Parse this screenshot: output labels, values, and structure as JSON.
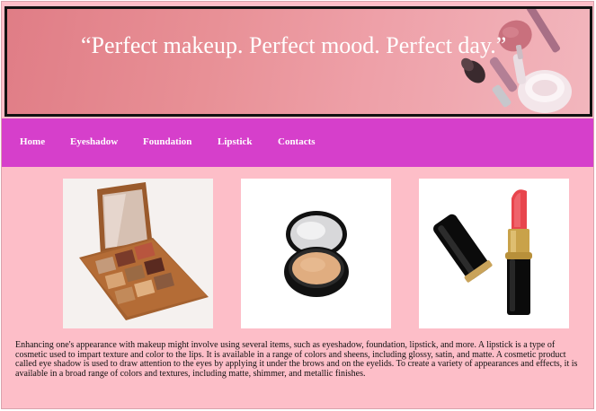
{
  "banner": {
    "quote": "“Perfect makeup. Perfect mood. Perfect day.”"
  },
  "nav": {
    "items": [
      {
        "label": "Home"
      },
      {
        "label": "Eyeshadow"
      },
      {
        "label": "Foundation"
      },
      {
        "label": "Lipstick"
      },
      {
        "label": "Contacts"
      }
    ]
  },
  "products": [
    {
      "icon": "eyeshadow-palette-icon"
    },
    {
      "icon": "compact-foundation-icon"
    },
    {
      "icon": "lipstick-icon"
    }
  ],
  "description": "Enhancing one's appearance with makeup might involve using several items, such as eyeshadow, foundation, lipstick, and more. A lipstick is a type of cosmetic used to impart texture and color to the lips. It is available in a range of colors and sheens, including glossy, satin, and matte. A cosmetic product called eye shadow is used to draw attention to the eyes by applying it under the brows and on the eyelids. To create a variety of appearances and effects, it is available in a broad range of colors and textures, including matte, shimmer, and metallic finishes.",
  "colors": {
    "page_background": "#fdbec8",
    "nav_background": "#d63fcb",
    "banner_border": "#111111"
  }
}
